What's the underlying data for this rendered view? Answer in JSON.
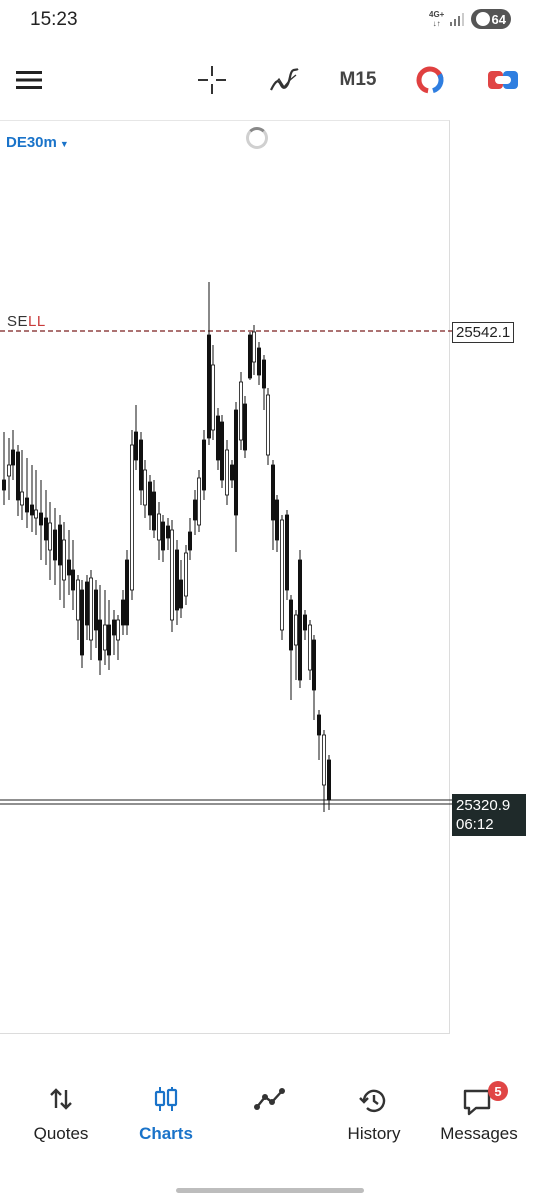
{
  "status_bar": {
    "time": "15:23",
    "network": "4G+",
    "battery": "64"
  },
  "toolbar": {
    "timeframe": "M15"
  },
  "chart": {
    "symbol": "DE30m",
    "sell_label_prefix": "SE",
    "sell_label_suffix": "LL",
    "sell_price": "25542.1",
    "current_price": "25320.9",
    "countdown": "06:12",
    "colors": {
      "sell_line": "#7a1d1d",
      "candle": "#111111",
      "accent": "#1a73c9"
    }
  },
  "bottom_nav": [
    {
      "id": "quotes",
      "label": "Quotes",
      "icon": "arrows-updown-icon",
      "active": false
    },
    {
      "id": "charts",
      "label": "Charts",
      "icon": "candles-icon",
      "active": true
    },
    {
      "id": "trade",
      "label": "",
      "icon": "trend-icon",
      "active": false
    },
    {
      "id": "history",
      "label": "History",
      "icon": "history-icon",
      "active": false
    },
    {
      "id": "messages",
      "label": "Messages",
      "icon": "message-icon",
      "active": false,
      "badge": "5"
    }
  ]
}
